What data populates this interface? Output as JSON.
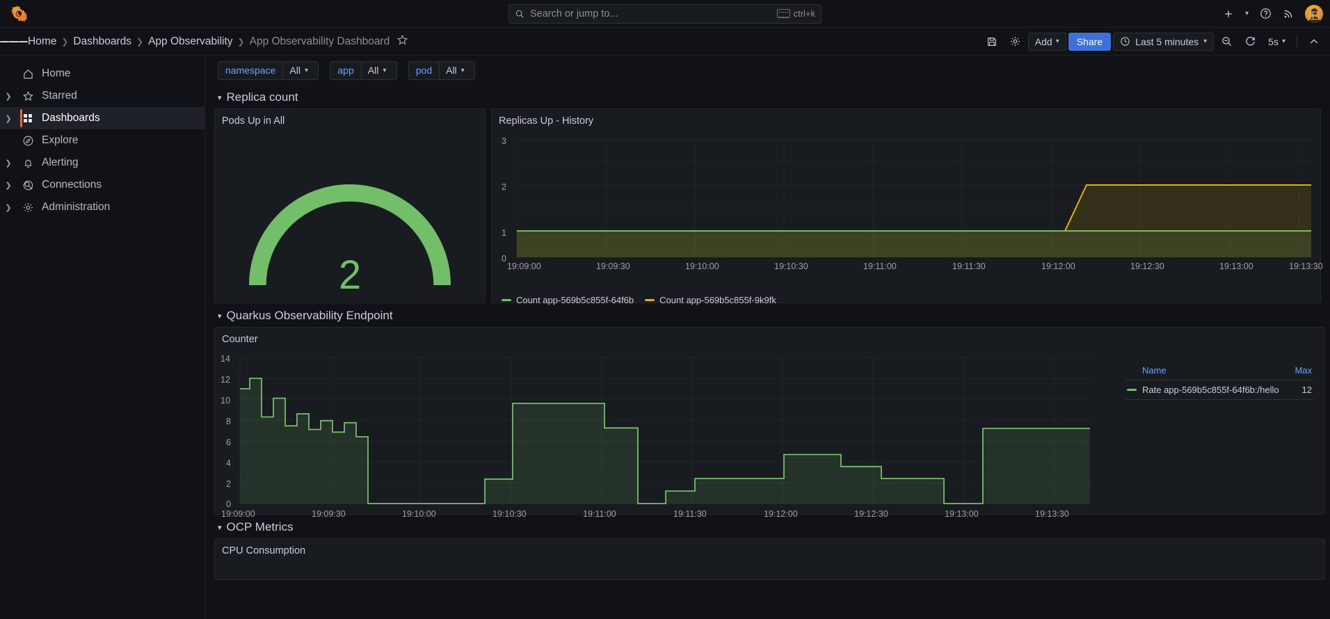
{
  "app": {
    "logo": "grafana-logo"
  },
  "search": {
    "placeholder": "Search or jump to...",
    "shortcut": "ctrl+k"
  },
  "breadcrumb": [
    {
      "label": "Home"
    },
    {
      "label": "Dashboards"
    },
    {
      "label": "App Observability"
    },
    {
      "label": "App Observability Dashboard"
    }
  ],
  "toolbar": {
    "save_label": "save-icon",
    "settings_label": "gear-icon",
    "add_label": "Add",
    "share_label": "Share",
    "time_range": "Last 5 minutes",
    "refresh_interval": "5s",
    "zoom_out_label": "zoom-out-icon",
    "refresh_label": "refresh-icon",
    "collapse_label": "chevron-up-icon"
  },
  "sidebar": {
    "items": [
      {
        "label": "Home",
        "icon": "home-icon",
        "expandable": false,
        "active": false
      },
      {
        "label": "Starred",
        "icon": "star-icon",
        "expandable": true,
        "active": false
      },
      {
        "label": "Dashboards",
        "icon": "dashboards-icon",
        "expandable": true,
        "active": true
      },
      {
        "label": "Explore",
        "icon": "compass-icon",
        "expandable": false,
        "active": false
      },
      {
        "label": "Alerting",
        "icon": "bell-icon",
        "expandable": true,
        "active": false
      },
      {
        "label": "Connections",
        "icon": "connections-icon",
        "expandable": true,
        "active": false
      },
      {
        "label": "Administration",
        "icon": "gear-icon",
        "expandable": true,
        "active": false
      }
    ],
    "dock_label": "dock-menu-icon"
  },
  "variables": [
    {
      "name": "namespace",
      "value": "All"
    },
    {
      "name": "app",
      "value": "All"
    },
    {
      "name": "pod",
      "value": "All"
    }
  ],
  "rows": [
    {
      "title": "Replica count"
    },
    {
      "title": "Quarkus Observability Endpoint"
    },
    {
      "title": "OCP Metrics"
    }
  ],
  "panels": {
    "gauge": {
      "title": "Pods Up in All",
      "value": "2",
      "min": 0,
      "max": 3,
      "color": "#73bf69"
    },
    "replicas": {
      "title": "Replicas Up - History"
    },
    "counter": {
      "title": "Counter"
    },
    "cpu": {
      "title": "CPU Consumption"
    }
  },
  "chart_data": [
    {
      "type": "gauge",
      "title": "Pods Up in All",
      "value": 2,
      "min": 0,
      "max": 3,
      "color": "#73bf69"
    },
    {
      "type": "area",
      "title": "Replicas Up - History",
      "xlabel": "",
      "ylabel": "",
      "ylim": [
        0,
        3
      ],
      "yticks": [
        0,
        1,
        2,
        3
      ],
      "xticks": [
        "19:09:00",
        "19:09:30",
        "19:10:00",
        "19:10:30",
        "19:11:00",
        "19:11:30",
        "19:12:00",
        "19:12:30",
        "19:13:00",
        "19:13:30"
      ],
      "grid": true,
      "legend_position": "bottom",
      "series": [
        {
          "name": "Count app-569b5c855f-64f6b",
          "color": "#73bf69",
          "x": [
            "19:09:00",
            "19:12:05",
            "19:13:50"
          ],
          "values": [
            1,
            1,
            1
          ]
        },
        {
          "name": "Count app-569b5c855f-9k9fk",
          "color": "#e0b400",
          "x": [
            "19:09:00",
            "19:12:05",
            "19:12:12",
            "19:13:50"
          ],
          "values": [
            1,
            1,
            2,
            2
          ]
        }
      ]
    },
    {
      "type": "area",
      "title": "Counter",
      "xlabel": "",
      "ylabel": "",
      "ylim": [
        0,
        14
      ],
      "yticks": [
        0,
        2,
        4,
        6,
        8,
        10,
        12,
        14
      ],
      "xticks": [
        "19:09:00",
        "19:09:30",
        "19:10:00",
        "19:10:30",
        "19:11:00",
        "19:11:30",
        "19:12:00",
        "19:12:30",
        "19:13:00",
        "19:13:30"
      ],
      "grid": true,
      "legend_position": "right",
      "legend_columns": [
        "Name",
        "Max"
      ],
      "series": [
        {
          "name": "Rate app-569b5c855f-64f6b:/hello",
          "color": "#73bf69",
          "max": 12,
          "step": true,
          "x": [
            "19:09:00",
            "19:09:04",
            "19:09:09",
            "19:09:13",
            "19:09:18",
            "19:09:22",
            "19:09:27",
            "19:09:31",
            "19:09:36",
            "19:09:40",
            "19:09:45",
            "19:09:49",
            "19:10:33",
            "19:10:47",
            "19:11:25",
            "19:11:33",
            "19:11:40",
            "19:11:53",
            "19:12:08",
            "19:12:21",
            "19:12:27",
            "19:12:40",
            "19:13:00",
            "19:13:12",
            "19:13:50"
          ],
          "values": [
            11,
            12,
            8.3,
            10.1,
            7.45,
            8.6,
            7.1,
            7.95,
            6.85,
            7.75,
            6.4,
            0,
            0,
            2.35,
            9.6,
            9.6,
            7.25,
            0,
            1.2,
            2.4,
            2.4,
            1.75,
            1.75,
            0,
            7.2
          ]
        }
      ]
    }
  ]
}
